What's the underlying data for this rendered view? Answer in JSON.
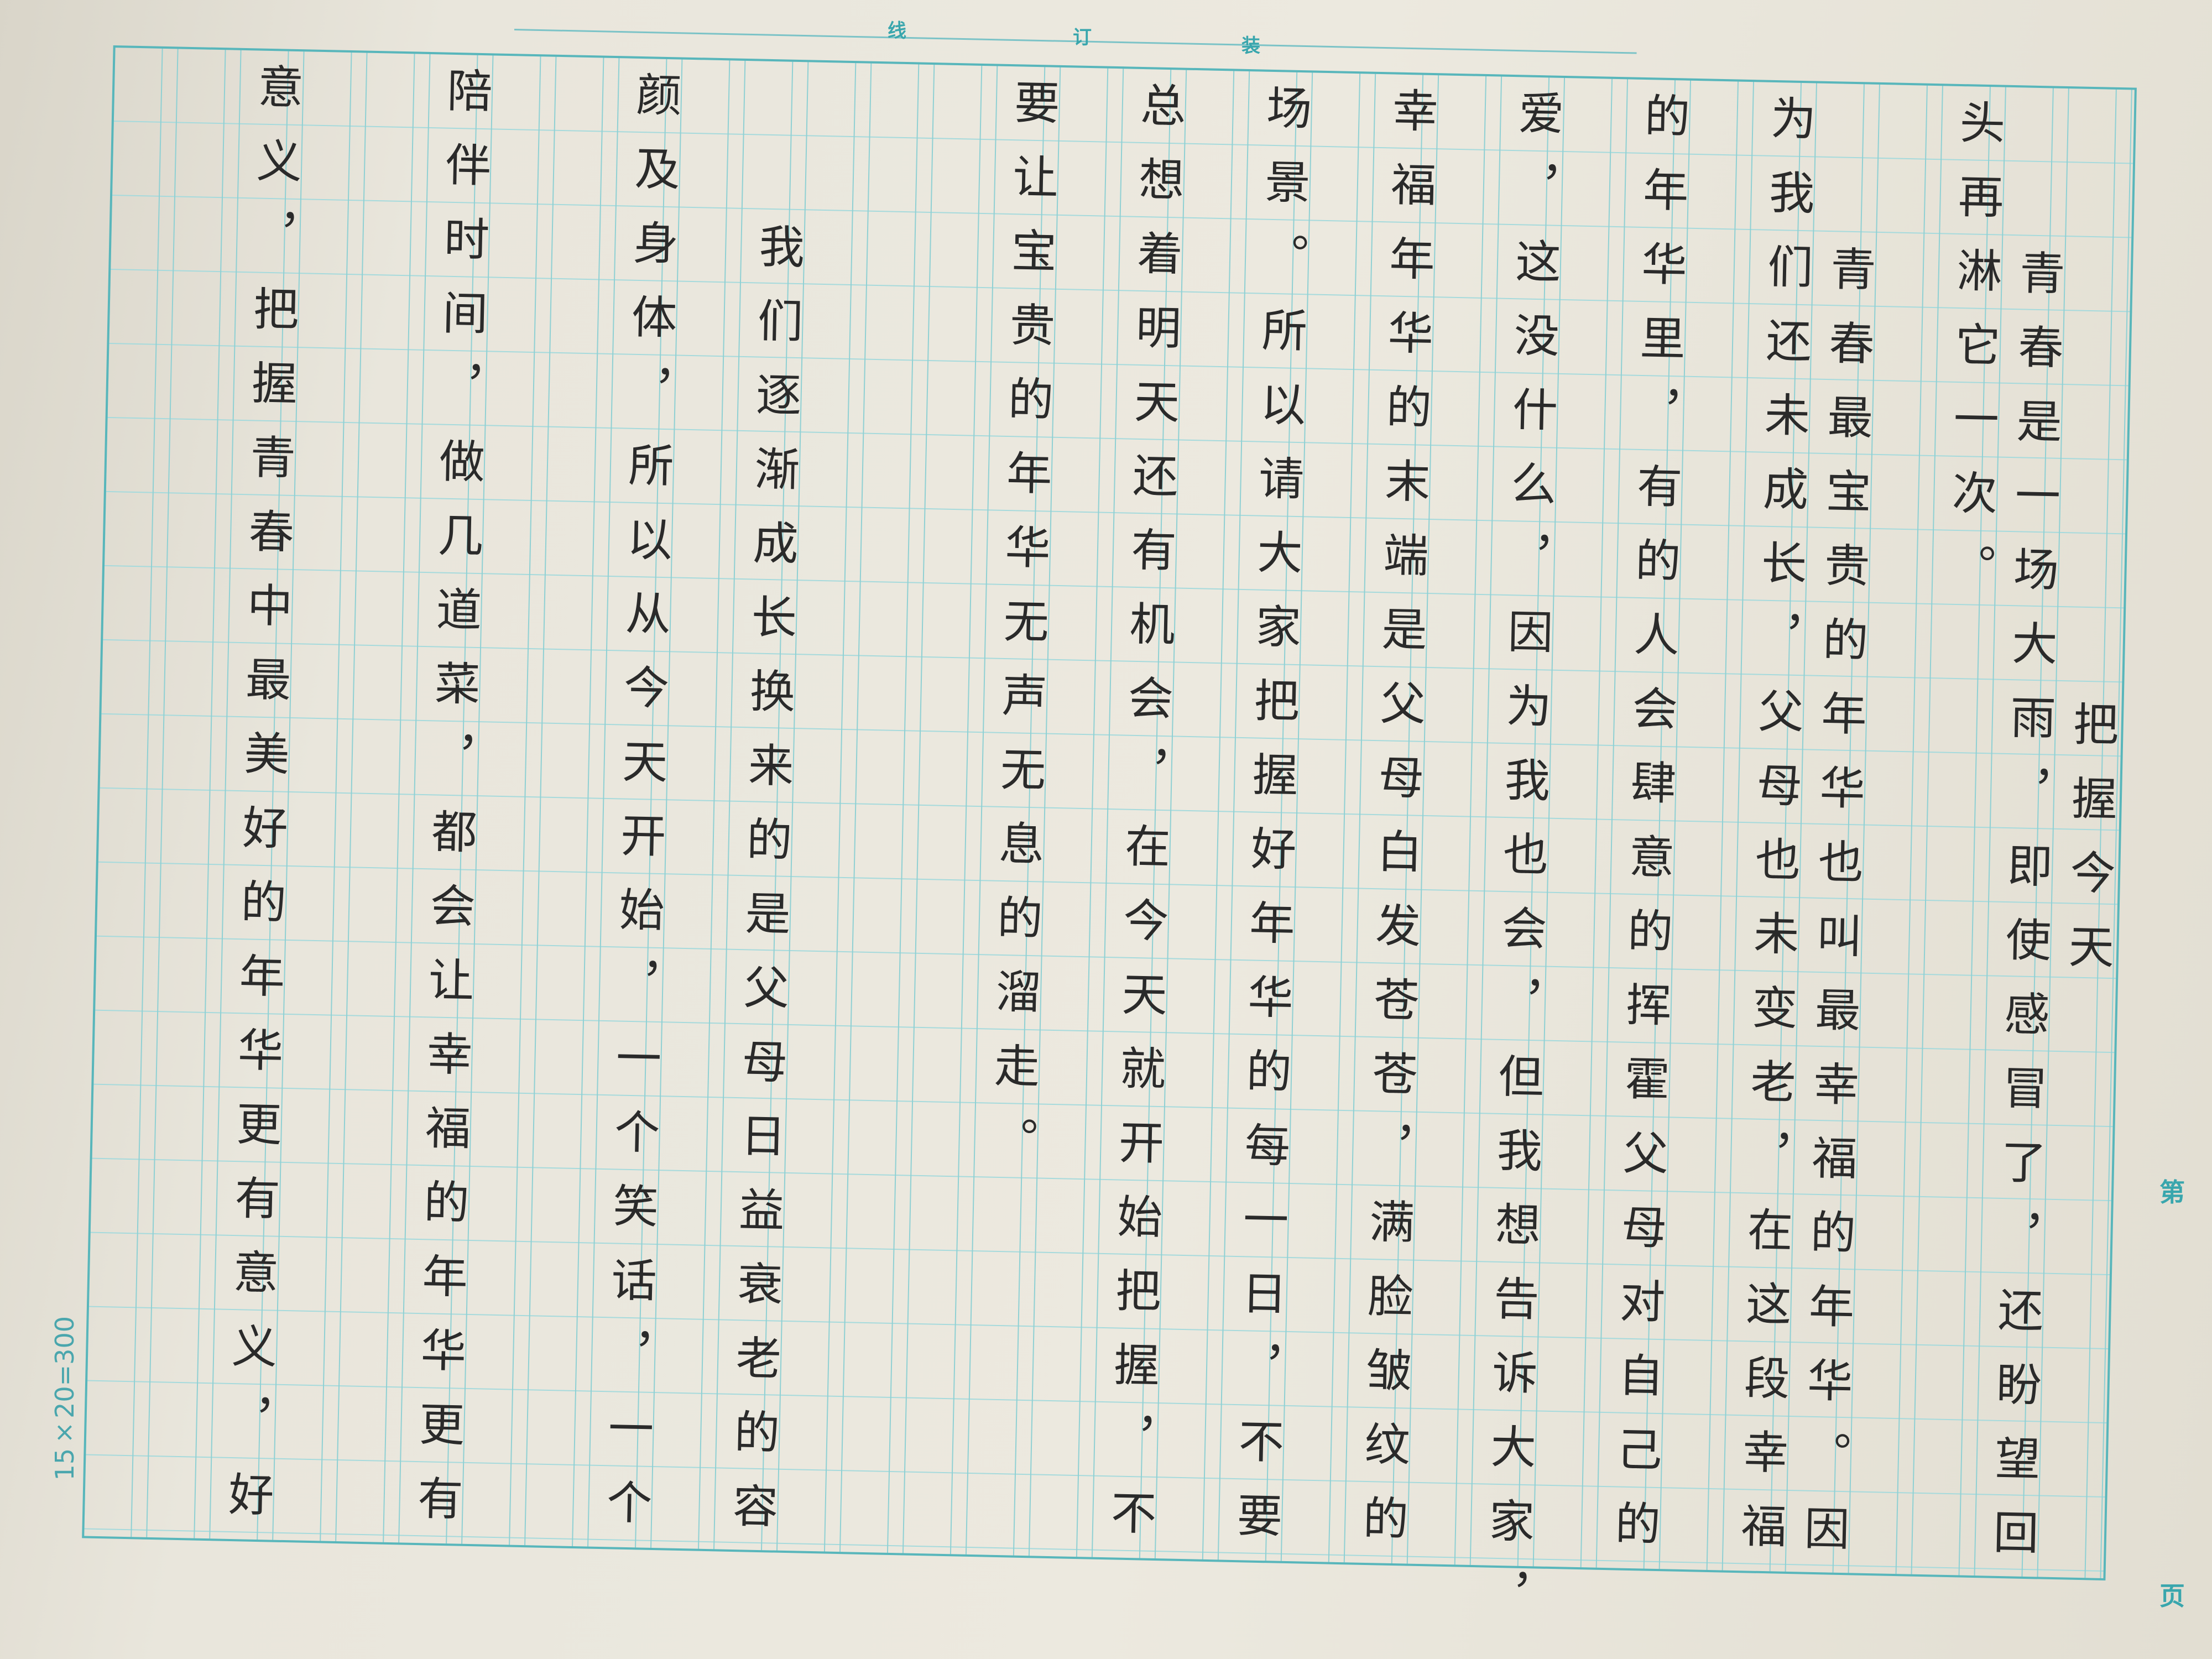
{
  "binding": {
    "mark_1": "装",
    "mark_2": "订",
    "mark_3": "线"
  },
  "title": "把握今天",
  "paragraphs": [
    "青春是一场大雨，即使感冒了，还盼望回头再淋它一次。",
    "青春最宝贵的年华也叫最幸福的年华。因为我们还未成长，父母也未变老，在这段幸福的年华里，有的人会肆意的挥霍父母对自己的爱，这没什么，因为我也会，但我想告诉大家，幸福年华的末端是父母白发苍苍，满脸皱纹的场景。所以请大家把握好年华的每一日，不要总想着明天还有机会，在今天就开始把握，不要让宝贵的年华无声无息的溜走。",
    "我们逐渐成长换来的是父母日益衰老的容颜及身体，所以从今天开始，一个笑话，一个陪伴时间，做几道菜，都会让幸福的年华更有意义，把握青春中最美好的年华更有意义，好"
  ],
  "columns": [
    "把握今天",
    "青春是一场大雨，即使感冒了，还盼望回",
    "头再淋它一次。",
    "青春最宝贵的年华也叫最幸福的年华。因",
    "为我们还未成长，父母也未变老，在这段幸福",
    "的年华里，有的人会肆意的挥霍父母对自己的",
    "爱，这没什么，因为我也会，但我想告诉大家，",
    "幸福年华的末端是父母白发苍苍，满脸皱纹的",
    "场景。所以请大家把握好年华的每一日，不要",
    "总想着明天还有机会，在今天就开始把握，不",
    "要让宝贵的年华无声无息的溜走。",
    "我们逐渐成长换来的是父母日益衰老的容",
    "颜及身体，所以从今天开始，一个笑话，一个",
    "陪伴时间，做几道菜，都会让幸福的年华更有",
    "意义，把握青春中最美好的年华更有意义，好"
  ],
  "footer": {
    "grid_count": "15×20=300",
    "page_prefix": "第",
    "page_suffix": "页"
  },
  "colors": {
    "grid_line": "#8fd0d3",
    "grid_border": "#58b6bb",
    "ink": "#2a2a2a"
  }
}
